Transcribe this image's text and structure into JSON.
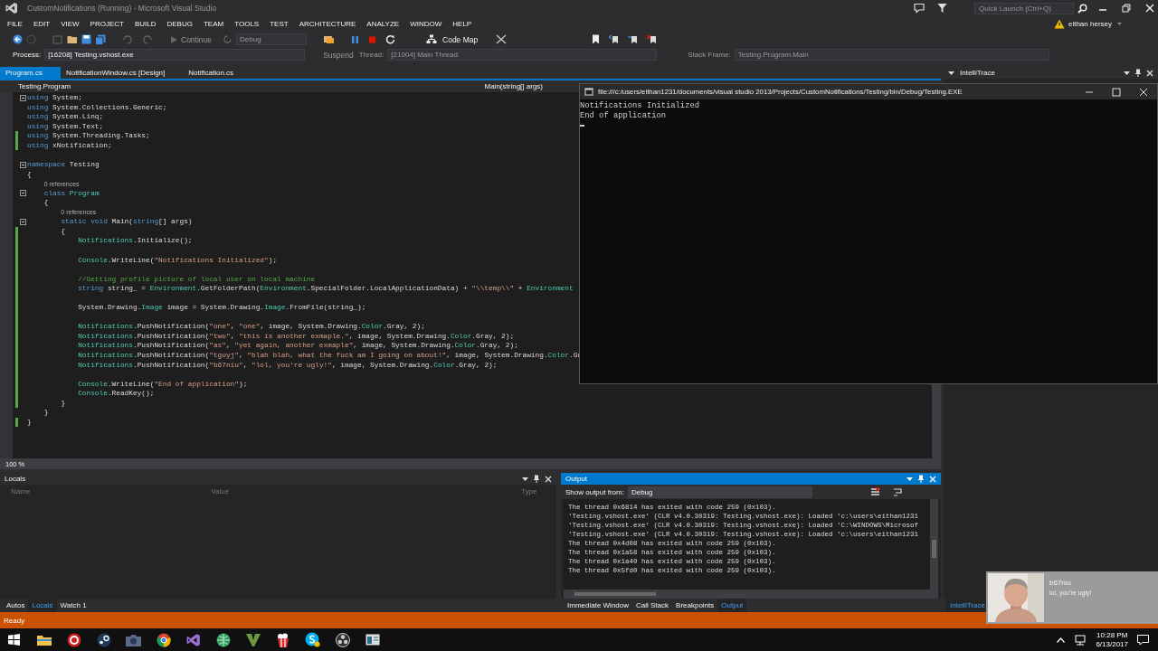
{
  "window": {
    "title": "CustomNotifications (Running) - Microsoft Visual Studio"
  },
  "quick_launch": {
    "placeholder": "Quick Launch (Ctrl+Q)"
  },
  "user": {
    "name": "eithan hersey"
  },
  "menu": [
    "FILE",
    "EDIT",
    "VIEW",
    "PROJECT",
    "BUILD",
    "DEBUG",
    "TEAM",
    "TOOLS",
    "TEST",
    "ARCHITECTURE",
    "ANALYZE",
    "WINDOW",
    "HELP"
  ],
  "toolbar": {
    "continue": "Continue",
    "configuration": "Debug",
    "code_map": "Code Map"
  },
  "debug_location": {
    "process_label": "Process:",
    "process": "[16208] Testing.vshost.exe",
    "suspend": "Suspend",
    "thread_label": "Thread:",
    "thread": "[21004] Main Thread",
    "stack_frame_label": "Stack Frame:",
    "stack_frame": "Testing.Program.Main"
  },
  "doc_tabs": [
    {
      "label": "Program.cs",
      "selected": true
    },
    {
      "label": "NotificationWindow.cs [Design]",
      "selected": false
    },
    {
      "label": "Notification.cs",
      "selected": false
    }
  ],
  "editor": {
    "type_nav": "Testing.Program",
    "member_nav": "Main(string[] args)",
    "zoom": "100 %",
    "lines": [
      {
        "kind": "code",
        "changed": false,
        "fold": true,
        "tokens": [
          {
            "text": "using",
            "kind": "keyword"
          },
          {
            "text": " System;",
            "kind": "plain"
          }
        ]
      },
      {
        "kind": "code",
        "changed": false,
        "fold": false,
        "tokens": [
          {
            "text": "using",
            "kind": "keyword"
          },
          {
            "text": " System.Collections.Generic;",
            "kind": "plain"
          }
        ]
      },
      {
        "kind": "code",
        "changed": false,
        "fold": false,
        "tokens": [
          {
            "text": "using",
            "kind": "keyword"
          },
          {
            "text": " System.Linq;",
            "kind": "plain"
          }
        ]
      },
      {
        "kind": "code",
        "changed": false,
        "fold": false,
        "tokens": [
          {
            "text": "using",
            "kind": "keyword"
          },
          {
            "text": " System.Text;",
            "kind": "plain"
          }
        ]
      },
      {
        "kind": "code",
        "changed": true,
        "fold": false,
        "tokens": [
          {
            "text": "using",
            "kind": "keyword"
          },
          {
            "text": " System.Threading.Tasks;",
            "kind": "plain"
          }
        ]
      },
      {
        "kind": "code",
        "changed": true,
        "fold": false,
        "tokens": [
          {
            "text": "using",
            "kind": "keyword"
          },
          {
            "text": " xNotification;",
            "kind": "plain"
          }
        ]
      },
      {
        "kind": "blank",
        "changed": false,
        "fold": false
      },
      {
        "kind": "code",
        "changed": false,
        "fold": true,
        "tokens": [
          {
            "text": "namespace",
            "kind": "keyword"
          },
          {
            "text": " Testing",
            "kind": "plain"
          }
        ]
      },
      {
        "kind": "code",
        "changed": false,
        "fold": false,
        "tokens": [
          {
            "text": "{",
            "kind": "plain"
          }
        ]
      },
      {
        "kind": "lens",
        "changed": false,
        "fold": false,
        "text": "    0 references"
      },
      {
        "kind": "code",
        "changed": false,
        "fold": true,
        "tokens": [
          {
            "text": "    class",
            "kind": "keyword"
          },
          {
            "text": " Program",
            "kind": "type"
          }
        ]
      },
      {
        "kind": "code",
        "changed": false,
        "fold": false,
        "tokens": [
          {
            "text": "    {",
            "kind": "plain"
          }
        ]
      },
      {
        "kind": "lens",
        "changed": false,
        "fold": false,
        "text": "        0 references"
      },
      {
        "kind": "code",
        "changed": false,
        "fold": true,
        "tokens": [
          {
            "text": "        static void",
            "kind": "keyword"
          },
          {
            "text": " Main(",
            "kind": "plain"
          },
          {
            "text": "string",
            "kind": "keyword"
          },
          {
            "text": "[] args)",
            "kind": "plain"
          }
        ]
      },
      {
        "kind": "code",
        "changed": true,
        "fold": false,
        "tokens": [
          {
            "text": "        {",
            "kind": "plain"
          }
        ]
      },
      {
        "kind": "code",
        "changed": true,
        "fold": false,
        "tokens": [
          {
            "text": "            Notifications",
            "kind": "type"
          },
          {
            "text": ".Initialize();",
            "kind": "plain"
          }
        ]
      },
      {
        "kind": "blank",
        "changed": true,
        "fold": false
      },
      {
        "kind": "code",
        "changed": true,
        "fold": false,
        "tokens": [
          {
            "text": "            Console",
            "kind": "type"
          },
          {
            "text": ".WriteLine(",
            "kind": "plain"
          },
          {
            "text": "\"Notifications Initialized\"",
            "kind": "string"
          },
          {
            "text": ");",
            "kind": "plain"
          }
        ]
      },
      {
        "kind": "blank",
        "changed": true,
        "fold": false
      },
      {
        "kind": "code",
        "changed": true,
        "fold": false,
        "tokens": [
          {
            "text": "            //Getting profile picture of local user on local machine",
            "kind": "comment"
          }
        ]
      },
      {
        "kind": "code",
        "changed": true,
        "fold": false,
        "tokens": [
          {
            "text": "            string",
            "kind": "keyword"
          },
          {
            "text": " string_ = ",
            "kind": "plain"
          },
          {
            "text": "Environment",
            "kind": "type"
          },
          {
            "text": ".GetFolderPath(",
            "kind": "plain"
          },
          {
            "text": "Environment",
            "kind": "type"
          },
          {
            "text": ".SpecialFolder.LocalApplicationData) + ",
            "kind": "plain"
          },
          {
            "text": "\"\\\\temp\\\\\"",
            "kind": "string"
          },
          {
            "text": " + ",
            "kind": "plain"
          },
          {
            "text": "Environment",
            "kind": "type"
          }
        ]
      },
      {
        "kind": "blank",
        "changed": true,
        "fold": false
      },
      {
        "kind": "code",
        "changed": true,
        "fold": false,
        "tokens": [
          {
            "text": "            System.Drawing.",
            "kind": "plain"
          },
          {
            "text": "Image",
            "kind": "type"
          },
          {
            "text": " image = System.Drawing.",
            "kind": "plain"
          },
          {
            "text": "Image",
            "kind": "type"
          },
          {
            "text": ".FromFile(string_);",
            "kind": "plain"
          }
        ]
      },
      {
        "kind": "blank",
        "changed": true,
        "fold": false
      },
      {
        "kind": "code",
        "changed": true,
        "fold": false,
        "tokens": [
          {
            "text": "            Notifications",
            "kind": "type"
          },
          {
            "text": ".PushNotification(",
            "kind": "plain"
          },
          {
            "text": "\"one\"",
            "kind": "string"
          },
          {
            "text": ", ",
            "kind": "plain"
          },
          {
            "text": "\"one\"",
            "kind": "string"
          },
          {
            "text": ", image, System.Drawing.",
            "kind": "plain"
          },
          {
            "text": "Color",
            "kind": "type"
          },
          {
            "text": ".Gray, 2);",
            "kind": "plain"
          }
        ]
      },
      {
        "kind": "code",
        "changed": true,
        "fold": false,
        "tokens": [
          {
            "text": "            Notifications",
            "kind": "type"
          },
          {
            "text": ".PushNotification(",
            "kind": "plain"
          },
          {
            "text": "\"two\"",
            "kind": "string"
          },
          {
            "text": ", ",
            "kind": "plain"
          },
          {
            "text": "\"this is another exmaple.\"",
            "kind": "string"
          },
          {
            "text": ", image, System.Drawing.",
            "kind": "plain"
          },
          {
            "text": "Color",
            "kind": "type"
          },
          {
            "text": ".Gray, 2);",
            "kind": "plain"
          }
        ]
      },
      {
        "kind": "code",
        "changed": true,
        "fold": false,
        "tokens": [
          {
            "text": "            Notifications",
            "kind": "type"
          },
          {
            "text": ".PushNotification(",
            "kind": "plain"
          },
          {
            "text": "\"as\"",
            "kind": "string"
          },
          {
            "text": ", ",
            "kind": "plain"
          },
          {
            "text": "\"yet again, another exmaple\"",
            "kind": "string"
          },
          {
            "text": ", image, System.Drawing.",
            "kind": "plain"
          },
          {
            "text": "Color",
            "kind": "type"
          },
          {
            "text": ".Gray, 2);",
            "kind": "plain"
          }
        ]
      },
      {
        "kind": "code",
        "changed": true,
        "fold": false,
        "tokens": [
          {
            "text": "            Notifications",
            "kind": "type"
          },
          {
            "text": ".PushNotification(",
            "kind": "plain"
          },
          {
            "text": "\"tguyj\"",
            "kind": "string"
          },
          {
            "text": ", ",
            "kind": "plain"
          },
          {
            "text": "\"blah blah, what the fuck am I going on about!\"",
            "kind": "string"
          },
          {
            "text": ", image, System.Drawing.",
            "kind": "plain"
          },
          {
            "text": "Color",
            "kind": "type"
          },
          {
            "text": ".Gr",
            "kind": "plain"
          }
        ]
      },
      {
        "kind": "code",
        "changed": true,
        "fold": false,
        "tokens": [
          {
            "text": "            Notifications",
            "kind": "type"
          },
          {
            "text": ".PushNotification(",
            "kind": "plain"
          },
          {
            "text": "\"b67niu\"",
            "kind": "string"
          },
          {
            "text": ", ",
            "kind": "plain"
          },
          {
            "text": "\"lol, you're ugly!\"",
            "kind": "string"
          },
          {
            "text": ", image, System.Drawing.",
            "kind": "plain"
          },
          {
            "text": "Color",
            "kind": "type"
          },
          {
            "text": ".Gray, 2);",
            "kind": "plain"
          }
        ]
      },
      {
        "kind": "blank",
        "changed": true,
        "fold": false
      },
      {
        "kind": "code",
        "changed": true,
        "fold": false,
        "tokens": [
          {
            "text": "            Console",
            "kind": "type"
          },
          {
            "text": ".WriteLine(",
            "kind": "plain"
          },
          {
            "text": "\"End of application\"",
            "kind": "string"
          },
          {
            "text": ");",
            "kind": "plain"
          }
        ]
      },
      {
        "kind": "code",
        "changed": true,
        "fold": false,
        "tokens": [
          {
            "text": "            Console",
            "kind": "type"
          },
          {
            "text": ".ReadKey();",
            "kind": "plain"
          }
        ]
      },
      {
        "kind": "code",
        "changed": true,
        "fold": false,
        "tokens": [
          {
            "text": "        }",
            "kind": "plain"
          }
        ]
      },
      {
        "kind": "code",
        "changed": false,
        "fold": false,
        "tokens": [
          {
            "text": "    }",
            "kind": "plain"
          }
        ]
      },
      {
        "kind": "code",
        "changed": true,
        "fold": false,
        "tokens": [
          {
            "text": "}",
            "kind": "plain"
          }
        ]
      }
    ]
  },
  "intellitrace": {
    "title": "IntelliTrace",
    "tab": "IntelliTrace"
  },
  "console": {
    "title": "file:///c:/users/eithan1231/documents/visual studio 2013/Projects/CustomNotifications/Testing/bin/Debug/Testing.EXE",
    "lines": [
      "Notifications Initialized",
      "End of application"
    ]
  },
  "locals": {
    "title": "Locals",
    "columns": [
      "Name",
      "Value",
      "Type"
    ]
  },
  "locals_tabs": [
    {
      "label": "Autos",
      "selected": false
    },
    {
      "label": "Locals",
      "selected": true
    },
    {
      "label": "Watch 1",
      "selected": false
    }
  ],
  "output": {
    "title": "Output",
    "show_from_label": "Show output from:",
    "source": "Debug",
    "lines": [
      "The thread 0x6814 has exited with code 259 (0x103).",
      "'Testing.vshost.exe' (CLR v4.0.30319: Testing.vshost.exe): Loaded 'c:\\users\\eithan1231",
      "'Testing.vshost.exe' (CLR v4.0.30319: Testing.vshost.exe): Loaded 'C:\\WINDOWS\\Microsof",
      "'Testing.vshost.exe' (CLR v4.0.30319: Testing.vshost.exe): Loaded 'c:\\users\\eithan1231",
      "The thread 0x4d08 has exited with code 259 (0x103).",
      "The thread 0x1a58 has exited with code 259 (0x103).",
      "The thread 0x1a40 has exited with code 259 (0x103).",
      "The thread 0x5fd0 has exited with code 259 (0x103)."
    ]
  },
  "output_tabs": [
    {
      "label": "Immediate Window",
      "selected": false
    },
    {
      "label": "Call Stack",
      "selected": false
    },
    {
      "label": "Breakpoints",
      "selected": false
    },
    {
      "label": "Output",
      "selected": true
    }
  ],
  "status_bar": {
    "text": "Ready"
  },
  "taskbar": {
    "time": "10:28 PM",
    "date": "6/13/2017"
  },
  "notification": {
    "title": "b67niu",
    "message": "lol, you're ugly!"
  }
}
